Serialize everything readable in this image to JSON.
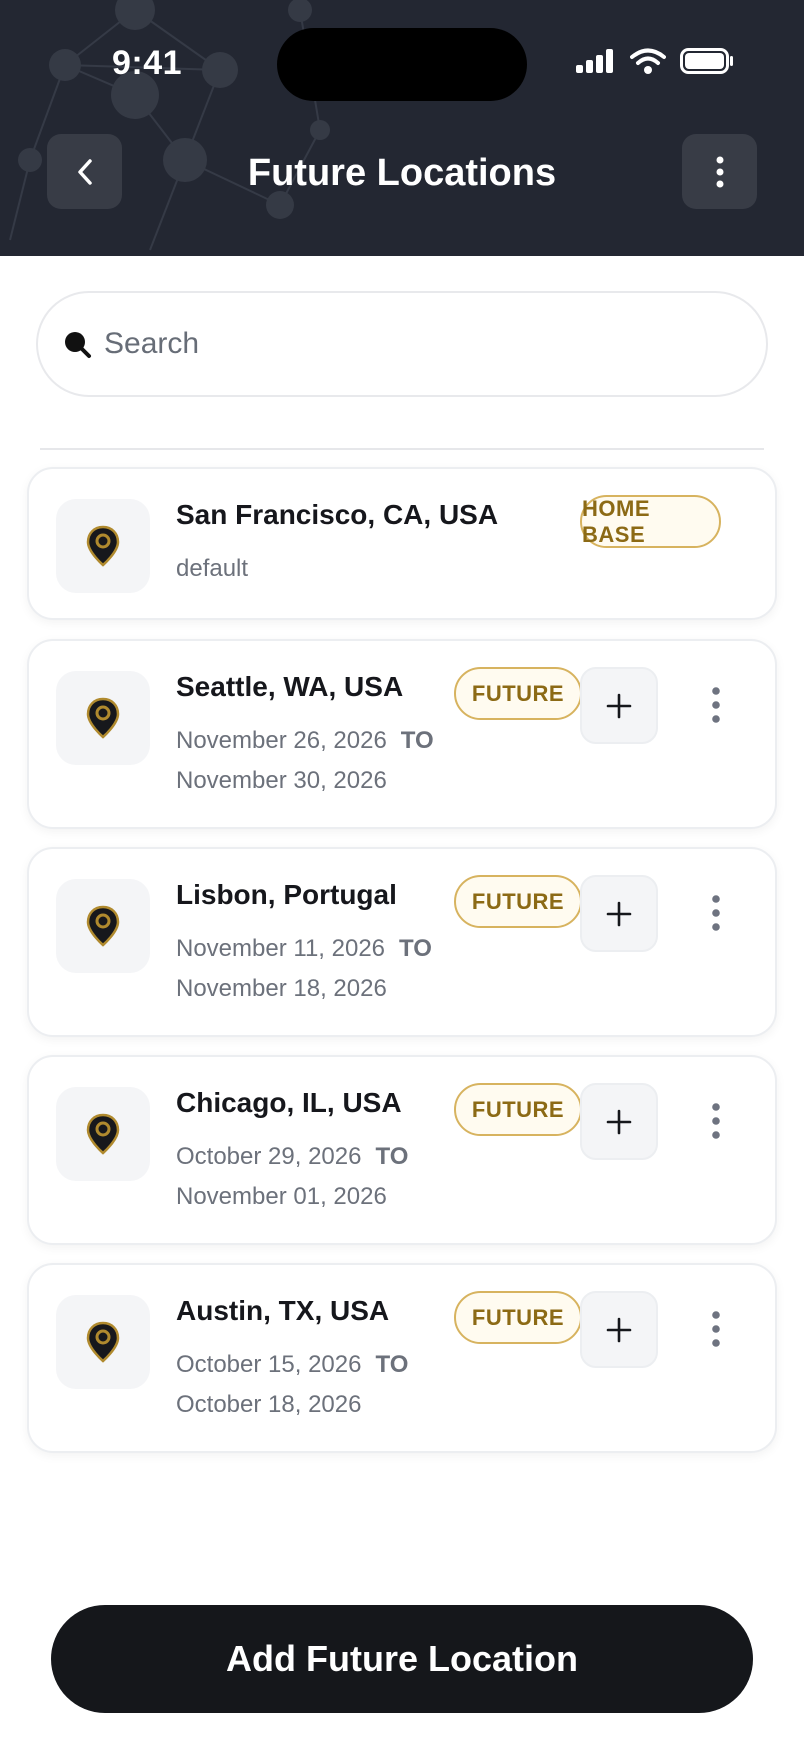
{
  "status_bar": {
    "time": "9:41"
  },
  "header": {
    "title": "Future Locations"
  },
  "search": {
    "placeholder": "Search"
  },
  "home_location": {
    "name": "San Francisco, CA, USA",
    "subtitle": "default",
    "badge": "HOME BASE"
  },
  "to_label": "TO",
  "future_badge": "FUTURE",
  "locations": [
    {
      "name": "Seattle, WA, USA",
      "start": "November 26, 2026",
      "end": "November 30, 2026"
    },
    {
      "name": "Lisbon, Portugal",
      "start": "November 11, 2026",
      "end": "November 18, 2026"
    },
    {
      "name": "Chicago, IL, USA",
      "start": "October 29, 2026",
      "end": "November 01, 2026"
    },
    {
      "name": "Austin, TX, USA",
      "start": "October 15, 2026",
      "end": "October 18, 2026"
    }
  ],
  "primary_action": {
    "label": "Add Future Location"
  },
  "colors": {
    "header_bg": "#232732",
    "accent_gold": "#8c6a15",
    "badge_border": "#d7b35f",
    "primary_button": "#15171b"
  },
  "icons": {
    "back": "chevron-left-icon",
    "more": "more-vertical-icon",
    "search": "search-icon",
    "location": "map-pin-icon",
    "add": "plus-icon"
  }
}
